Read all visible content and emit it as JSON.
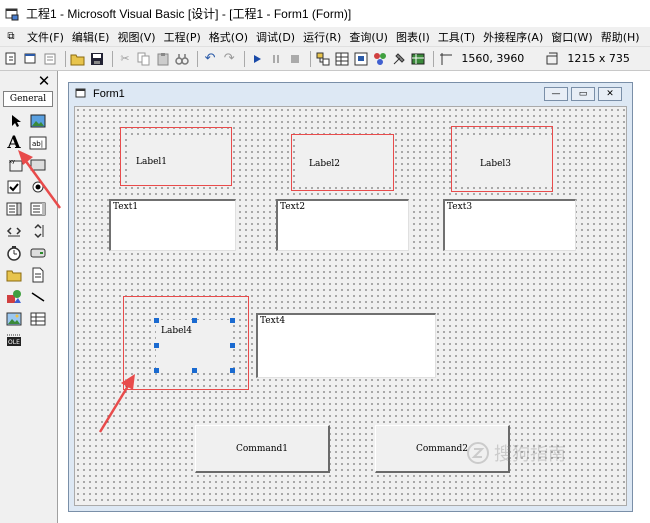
{
  "window": {
    "title": "工程1 - Microsoft Visual Basic [设计] - [工程1 - Form1 (Form)]"
  },
  "menu": [
    "文件(F)",
    "编辑(E)",
    "视图(V)",
    "工程(P)",
    "格式(O)",
    "调试(D)",
    "运行(R)",
    "查询(U)",
    "图表(I)",
    "工具(T)",
    "外接程序(A)",
    "窗口(W)",
    "帮助(H)"
  ],
  "toolbar": {
    "position": "1560, 3960",
    "size": "1215 x 735"
  },
  "toolbox": {
    "title": "General"
  },
  "form": {
    "title": "Form1",
    "labels": [
      "Label1",
      "Label2",
      "Label3",
      "Label4"
    ],
    "textboxes": [
      "Text1",
      "Text2",
      "Text3",
      "Text4"
    ],
    "buttons": [
      "Command1",
      "Command2"
    ]
  },
  "colors": {
    "annotation": "#e84b4b",
    "selection_handle": "#1a6ad0"
  },
  "watermark": "搜狗指南"
}
